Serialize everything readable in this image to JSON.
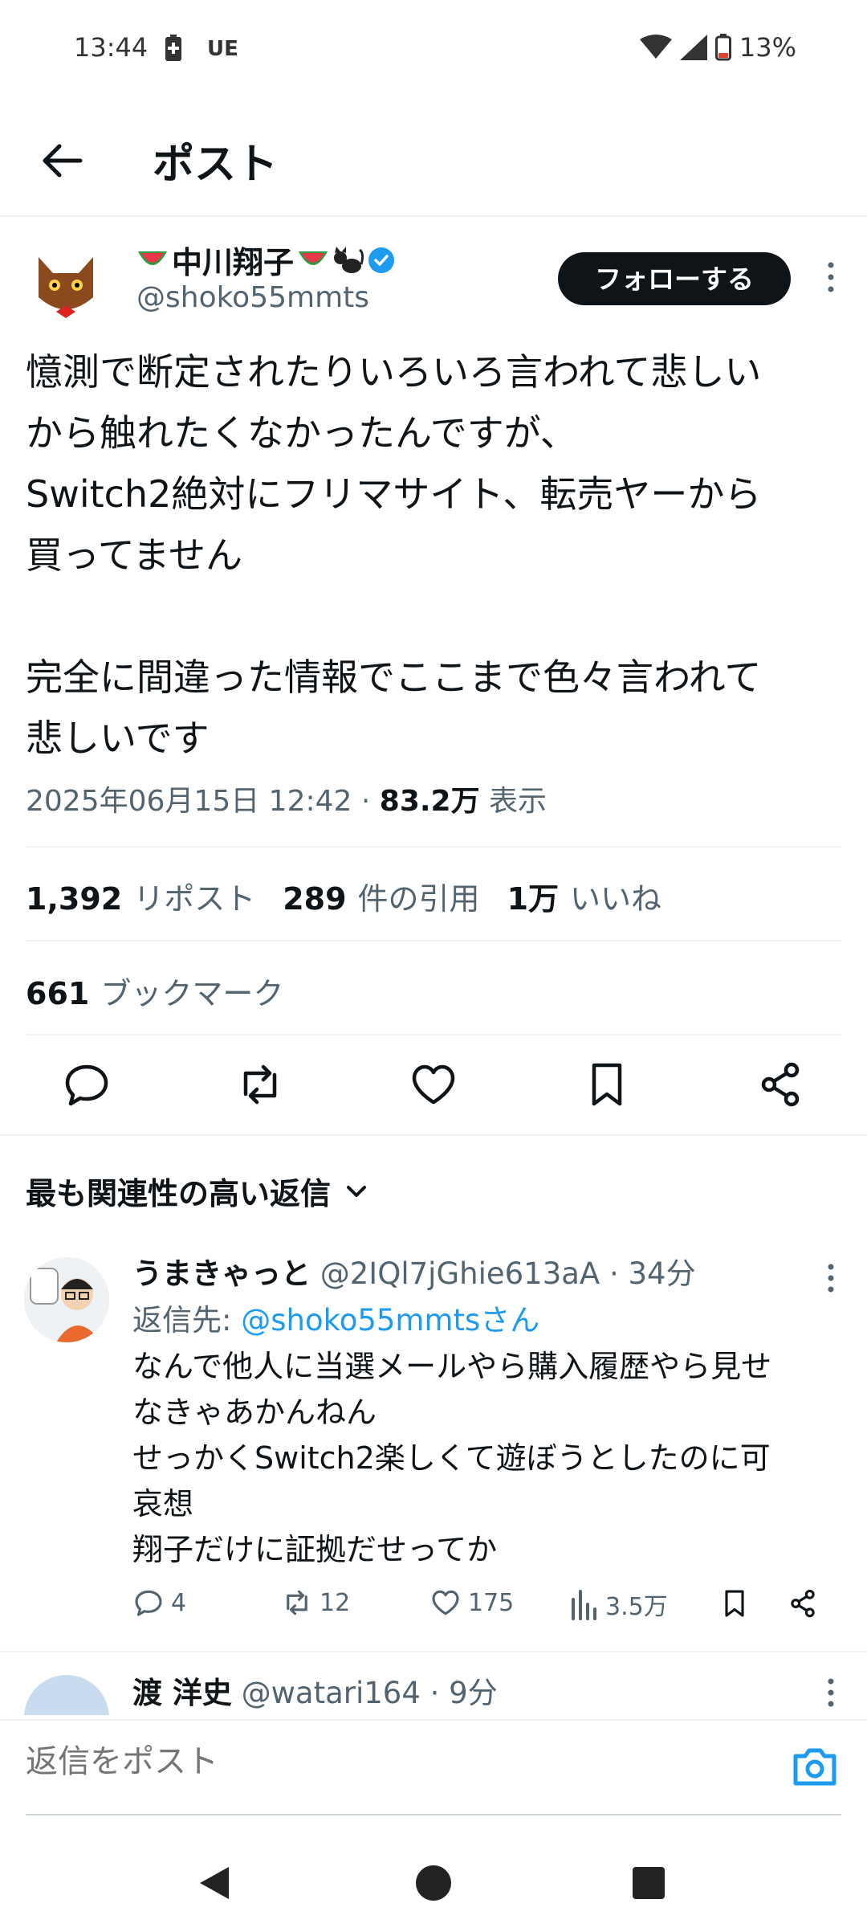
{
  "status": {
    "time": "13:44",
    "carrier": "UE",
    "battery": "13%"
  },
  "header": {
    "title": "ポスト"
  },
  "post": {
    "author_name": "中川翔子",
    "author_handle": "@shoko55mmts",
    "follow_label": "フォローする",
    "text": "憶測で断定されたりいろいろ言われて悲しい\nから触れたくなかったんですが、\nSwitch2絶対にフリマサイト、転売ヤーから\n買ってません\n\n完全に間違った情報でここまで色々言われて\n悲しいです",
    "datetime": "2025年06月15日 12:42 · ",
    "views_count": "83.2万",
    "views_label": "表示",
    "stats": {
      "reposts_count": "1,392",
      "reposts_label": "リポスト",
      "quotes_count": "289",
      "quotes_label": "件の引用",
      "likes_count": "1万",
      "likes_label": "いいね",
      "bookmarks_count": "661",
      "bookmarks_label": "ブックマーク"
    }
  },
  "replies_sort": {
    "label": "最も関連性の高い返信"
  },
  "reply1": {
    "name": "うまきゃっと",
    "handle": "@2IQl7jGhie613aA",
    "time": "· 34分",
    "reply_to_prefix": "返信先: ",
    "reply_to_handle": "@shoko55mmtsさん",
    "text": "なんで他人に当選メールやら購入履歴やら見せ\nなきゃあかんねん\nせっかくSwitch2楽しくて遊ぼうとしたのに可\n哀想\n翔子だけに証拠だせってか",
    "replies": "4",
    "reposts": "12",
    "likes": "175",
    "views": "3.5万"
  },
  "reply2": {
    "name": "渡 洋史",
    "handle": "@watari164",
    "time": "· 9分"
  },
  "compose": {
    "placeholder": "返信をポスト"
  },
  "colors": {
    "accent": "#1d9bf0",
    "text": "#0f1419",
    "muted": "#536471"
  }
}
